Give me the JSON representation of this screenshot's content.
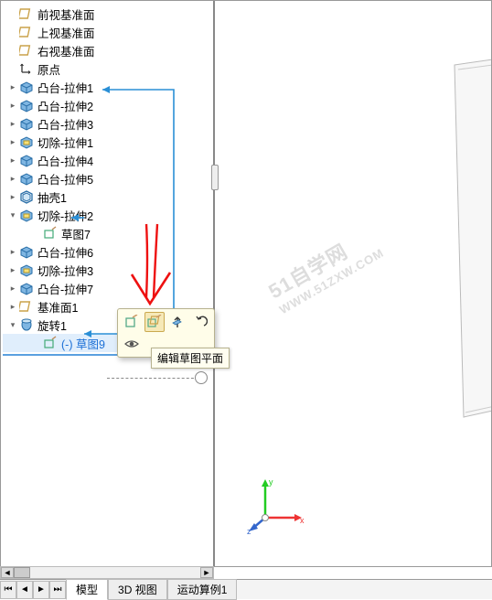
{
  "tree": {
    "planes": [
      {
        "label": "前视基准面"
      },
      {
        "label": "上视基准面"
      },
      {
        "label": "右视基准面"
      }
    ],
    "origin": "原点",
    "features": [
      {
        "label": "凸台-拉伸1",
        "kind": "boss"
      },
      {
        "label": "凸台-拉伸2",
        "kind": "boss"
      },
      {
        "label": "凸台-拉伸3",
        "kind": "boss"
      },
      {
        "label": "切除-拉伸1",
        "kind": "cut"
      },
      {
        "label": "凸台-拉伸4",
        "kind": "boss"
      },
      {
        "label": "凸台-拉伸5",
        "kind": "boss"
      },
      {
        "label": "抽壳1",
        "kind": "shell"
      },
      {
        "label": "切除-拉伸2",
        "kind": "cut",
        "expanded": true,
        "children": [
          {
            "label": "草图7",
            "kind": "sketch"
          }
        ]
      },
      {
        "label": "凸台-拉伸6",
        "kind": "boss"
      },
      {
        "label": "切除-拉伸3",
        "kind": "cut"
      },
      {
        "label": "凸台-拉伸7",
        "kind": "boss"
      },
      {
        "label": "基准面1",
        "kind": "datum"
      },
      {
        "label": "旋转1",
        "kind": "revolve",
        "expanded": true,
        "children": [
          {
            "label": "(-) 草图9",
            "kind": "sketch",
            "selected": true
          }
        ]
      }
    ]
  },
  "tooltip": {
    "text": "编辑草图平面"
  },
  "tabs": {
    "items": [
      {
        "label": "模型",
        "active": true
      },
      {
        "label": "3D 视图",
        "active": false
      },
      {
        "label": "运动算例1",
        "active": false
      }
    ]
  },
  "triad": {
    "axes": [
      "x",
      "y",
      "z"
    ]
  },
  "watermark": {
    "line1": "51自学网",
    "line2": "WWW.51ZXW.COM"
  },
  "ctx": {
    "buttons": [
      {
        "name": "edit-sketch",
        "row": 0
      },
      {
        "name": "edit-sketch-plane",
        "row": 0,
        "hover": true
      },
      {
        "name": "normal-to",
        "row": 0
      },
      {
        "name": "undo",
        "row": 0
      },
      {
        "name": "eye-visibility",
        "row": 1
      }
    ]
  }
}
